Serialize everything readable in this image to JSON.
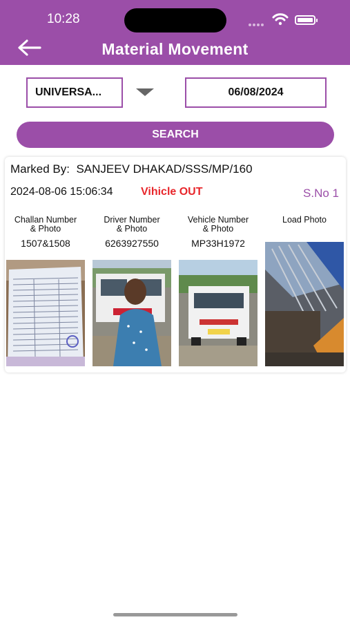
{
  "status_bar": {
    "time": "10:28"
  },
  "header": {
    "title": "Material Movement"
  },
  "filters": {
    "selected_site": "UNIVERSA...",
    "date": "06/08/2024",
    "search_label": "SEARCH"
  },
  "record": {
    "marked_by_label": "Marked By:",
    "marked_by_value": "SANJEEV DHAKAD/SSS/MP/160",
    "datetime": "2024-08-06 15:06:34",
    "status": "Vihicle OUT",
    "serial": "S.No 1",
    "columns": [
      {
        "header_line1": "Challan Number",
        "header_line2": "& Photo",
        "value": "1507&1508"
      },
      {
        "header_line1": "Driver Number",
        "header_line2": "& Photo",
        "value": "6263927550"
      },
      {
        "header_line1": "Vehicle Number",
        "header_line2": "& Photo",
        "value": "MP33H1972"
      },
      {
        "header_line1": "Load Photo",
        "header_line2": "",
        "value": ""
      }
    ]
  },
  "colors": {
    "accent": "#9b4ea8",
    "status_out": "#e8262b"
  }
}
